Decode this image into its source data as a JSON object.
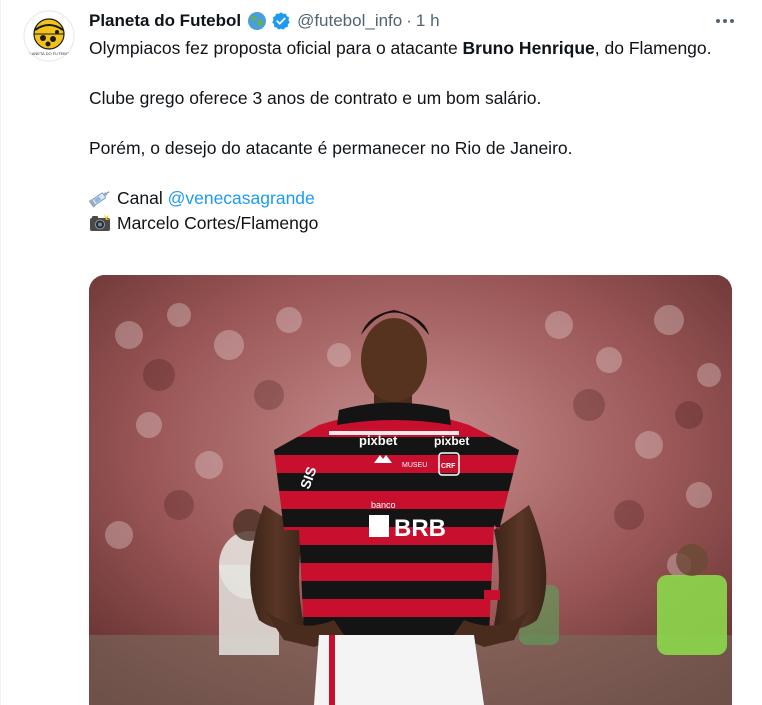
{
  "tweet": {
    "author_name": "Planeta do Futebol",
    "handle": "@futebol_info",
    "separator": "·",
    "time": "1 h",
    "line1_pre": "Olympiacos fez proposta oficial para o atacante ",
    "line1_bold": "Bruno Henrique",
    "line1_post": ", do Flamengo.",
    "line2": "Clube grego oferece 3 anos de contrato e um bom salário.",
    "line3": "Porém, o desejo do atacante é permanecer no Rio de Janeiro.",
    "canal_label": "Canal ",
    "canal_mention": "@venecasagrande",
    "photo_credit": "Marcelo Cortes/Flamengo",
    "icons": {
      "globe": "globe-emoji",
      "verified": "verified-badge",
      "more": "more-horizontal",
      "canal": "syringe-emoji",
      "camera": "camera-flash-emoji"
    },
    "media": {
      "shirt_sponsor": "pixbet",
      "shirt_sleeve": "SIS",
      "shirt_banco": "banco",
      "shirt_brb": "BRB",
      "shirt_museum": "MUSEU",
      "shirt_crest": "CRF"
    }
  },
  "colors": {
    "accent": "#1d9bf0",
    "secondary_text": "#536471",
    "verified": "#1d9bf0"
  }
}
